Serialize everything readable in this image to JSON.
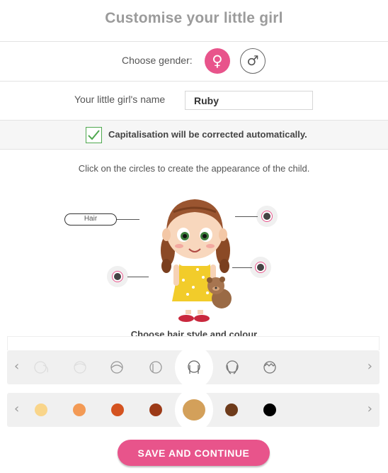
{
  "page": {
    "title": "Customise your little girl"
  },
  "gender": {
    "label": "Choose gender:",
    "female_symbol": "♀",
    "male_symbol": "♂",
    "selected": "female",
    "accent": "#e8548b"
  },
  "name": {
    "label": "Your little girl's name",
    "value": "Ruby"
  },
  "capitalisation": {
    "checked": true,
    "text": "Capitalisation will be corrected automatically."
  },
  "instructions": {
    "text": "Click on the circles to create the appearance of the child."
  },
  "hotspots": {
    "hair_label": "Hair"
  },
  "hair_section": {
    "title": "Choose hair style and colour",
    "styles": [
      "hair-style-1-icon",
      "hair-style-2-icon",
      "hair-style-3-icon",
      "hair-style-4-icon",
      "hair-style-5-icon",
      "hair-style-6-icon",
      "hair-style-7-icon"
    ],
    "selected_style": 5,
    "colors": [
      "#f9d58a",
      "#f39a55",
      "#d45320",
      "#9c3a17",
      "#d3a05a",
      "#6e3b1b",
      "#000000"
    ],
    "selected_color": 5
  },
  "save": {
    "label": "SAVE AND CONTINUE"
  }
}
